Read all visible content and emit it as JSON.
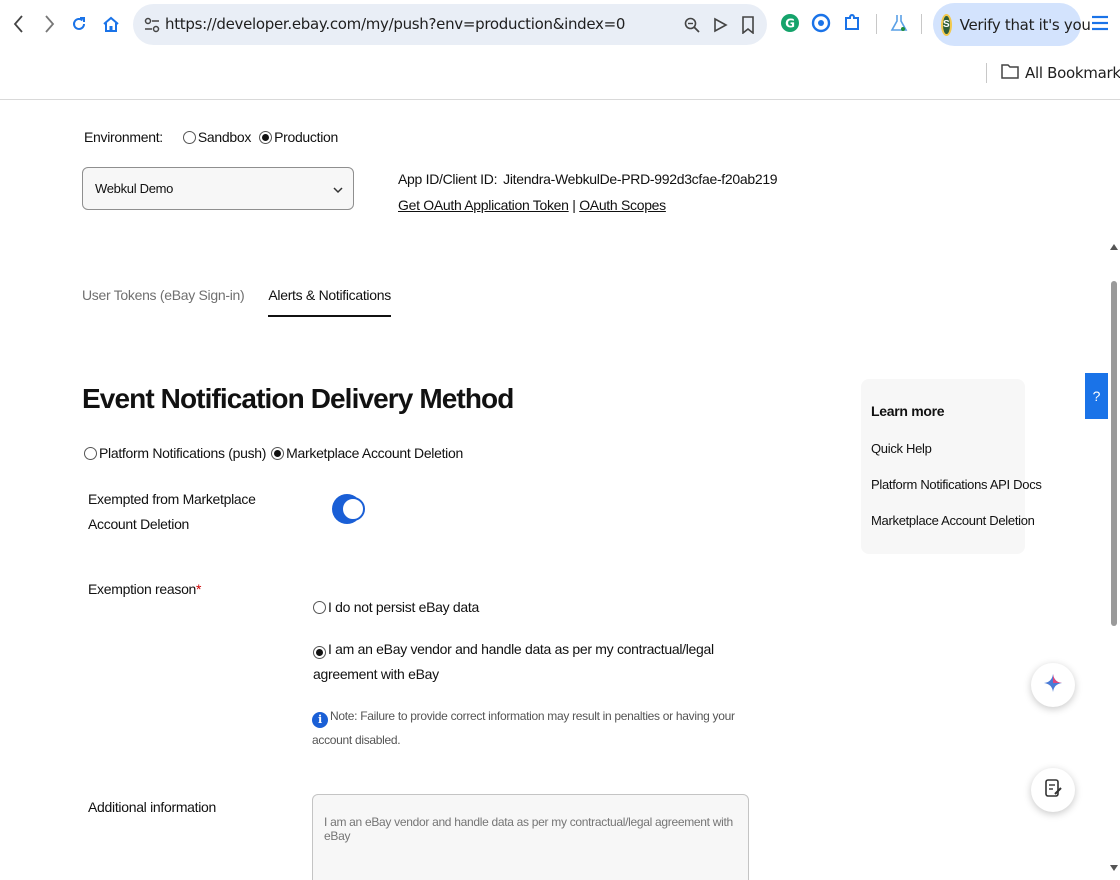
{
  "browser": {
    "url": "https://developer.ebay.com/my/push?env=production&index=0",
    "profile_button": "Verify that it's you",
    "profile_avatar_letter": "S",
    "bookmarks_label": "All Bookmarks"
  },
  "environment": {
    "label": "Environment:",
    "options": [
      "Sandbox",
      "Production"
    ],
    "selected": "Production"
  },
  "app_selector": {
    "value": "Webkul Demo"
  },
  "app_id": {
    "label": "App ID/Client ID:",
    "value": "Jitendra-WebkulDe-PRD-992d3cfae-f20ab219",
    "token_link": "Get OAuth Application Token",
    "separator": "|",
    "scopes_link": "OAuth Scopes"
  },
  "tabs": [
    {
      "label": "User Tokens (eBay Sign-in)",
      "active": false
    },
    {
      "label": "Alerts & Notifications",
      "active": true
    }
  ],
  "main": {
    "title": "Event Notification Delivery Method",
    "method_options": [
      "Platform Notifications (push)",
      "Marketplace Account Deletion"
    ],
    "method_selected": "Marketplace Account Deletion",
    "exempt_label": "Exempted from Marketplace Account Deletion",
    "exempt_enabled": true,
    "reason_label": "Exemption reason",
    "reason_required_mark": "*",
    "reason_options": [
      "I do not persist eBay data",
      "I am an eBay vendor and handle data as per my contractual/legal agreement with eBay"
    ],
    "reason_selected_index": 1,
    "note": "Note: Failure to provide correct information may result in penalties or having your account disabled.",
    "info_icon_glyph": "i",
    "additional_label": "Additional information",
    "additional_placeholder": "I am an eBay vendor and handle data as per my contractual/legal agreement with eBay"
  },
  "learn_more": {
    "title": "Learn more",
    "links": [
      "Quick Help",
      "Platform Notifications API Docs",
      "Marketplace Account Deletion"
    ]
  },
  "help_tab": "?",
  "colors": {
    "accent": "#1a5fd6",
    "help_tab": "#1a73e8",
    "card_bg": "#f7f7f7"
  },
  "icons": [
    "back-icon",
    "forward-icon",
    "reload-icon",
    "home-icon",
    "site-info-icon",
    "zoom-icon",
    "send-icon",
    "bookmark-star-icon",
    "grammarly-icon",
    "extension-icon",
    "puzzle-icon",
    "labs-icon",
    "menu-icon",
    "folder-icon",
    "chevron-down-icon",
    "info-icon",
    "sparkle-icon",
    "notes-icon"
  ]
}
